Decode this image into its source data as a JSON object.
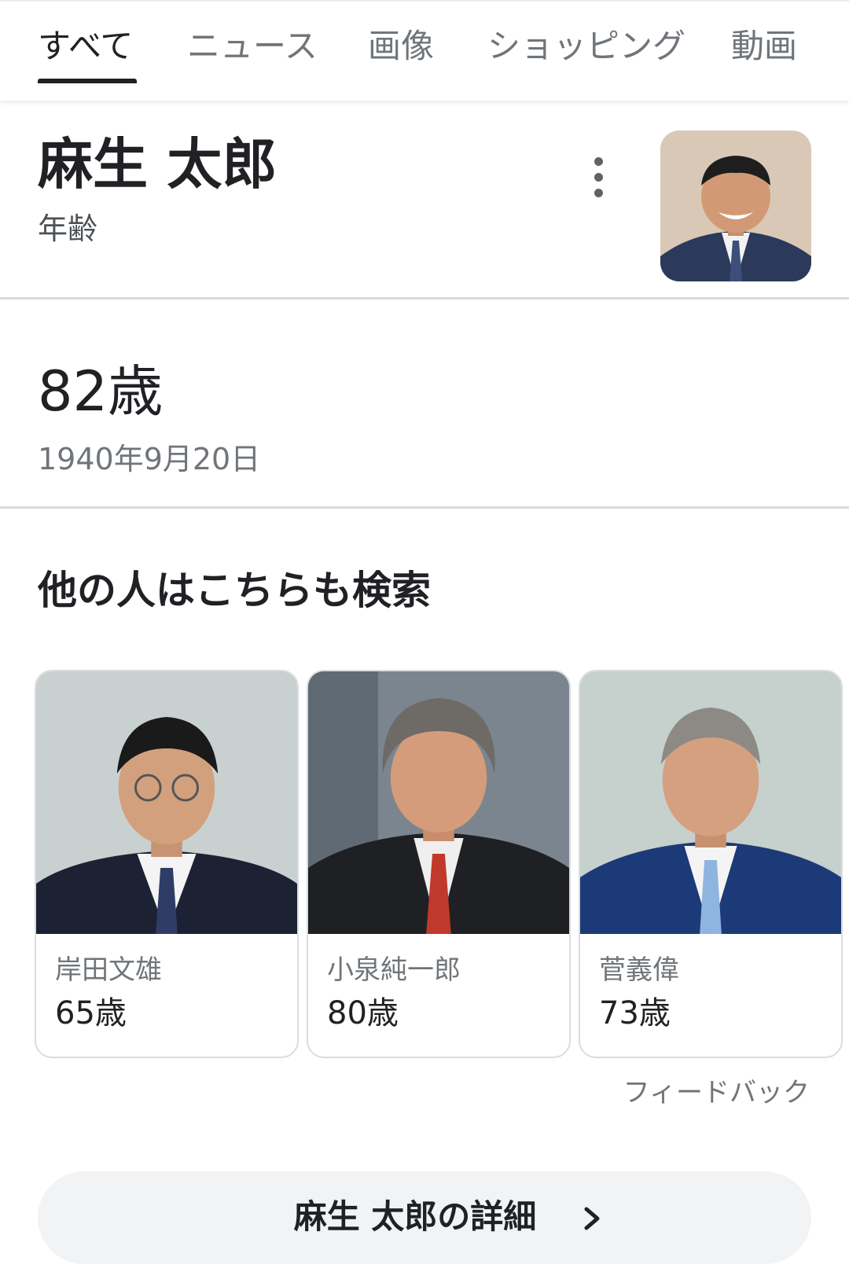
{
  "tabs": [
    {
      "label": "すべて",
      "active": true
    },
    {
      "label": "ニュース",
      "active": false
    },
    {
      "label": "画像",
      "active": false
    },
    {
      "label": "ショッピング",
      "active": false
    },
    {
      "label": "動画",
      "active": false
    }
  ],
  "entity": {
    "name": "麻生 太郎",
    "attribute": "年齢",
    "more_icon": "more-vert-icon"
  },
  "answer": {
    "age": "82歳",
    "birthdate": "1940年9月20日"
  },
  "related": {
    "title": "他の人はこちらも検索",
    "people": [
      {
        "name": "岸田文雄",
        "age": "65歳"
      },
      {
        "name": "小泉純一郎",
        "age": "80歳"
      },
      {
        "name": "菅義偉",
        "age": "73歳"
      }
    ],
    "feedback": "フィードバック"
  },
  "details_button": {
    "label": "麻生 太郎の詳細",
    "icon": "chevron-right-icon"
  },
  "colors": {
    "text_primary": "#202124",
    "text_secondary": "#70757a",
    "divider": "#dadce0",
    "button_bg": "#f1f3f4"
  }
}
